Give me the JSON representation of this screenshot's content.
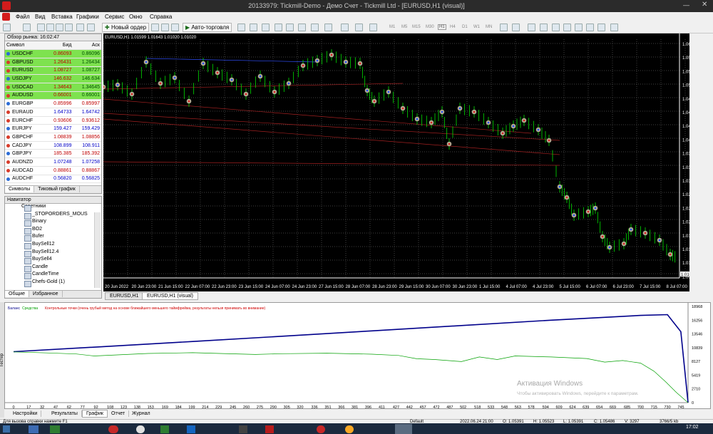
{
  "window": {
    "title": "20133979: Tickmill-Demo - Демо Счет - Tickmill Ltd - [EURUSD,H1 (visual)]"
  },
  "menu": [
    "Файл",
    "Вид",
    "Вставка",
    "Графики",
    "Сервис",
    "Окно",
    "Справка"
  ],
  "toolbar": {
    "new_order": "Новый ордер",
    "auto_trading": "Авто-торговля",
    "timeframes": [
      "M1",
      "M5",
      "M15",
      "M30",
      "H1",
      "H4",
      "D1",
      "W1",
      "MN"
    ]
  },
  "market_watch": {
    "title": "Обзор рынка: 16:02:47",
    "headers": [
      "Символ",
      "Бид",
      "Аск"
    ],
    "rows": [
      [
        "USDCHF",
        "0.86093",
        "0.86096"
      ],
      [
        "GBPUSD",
        "1.26431",
        "1.26434"
      ],
      [
        "EURUSD",
        "1.08727",
        "1.08727"
      ],
      [
        "USDJPY",
        "146.632",
        "146.634"
      ],
      [
        "USDCAD",
        "1.34643",
        "1.34645"
      ],
      [
        "AUDUSD",
        "0.66001",
        "0.66001"
      ],
      [
        "EURGBP",
        "0.85996",
        "0.85997"
      ],
      [
        "EURAUD",
        "1.64733",
        "1.64742"
      ],
      [
        "EURCHF",
        "0.93606",
        "0.93612"
      ],
      [
        "EURJPY",
        "159.427",
        "159.429"
      ],
      [
        "GBPCHF",
        "1.08839",
        "1.08856"
      ],
      [
        "CADJPY",
        "108.899",
        "108.911"
      ],
      [
        "GBPJPY",
        "185.385",
        "185.392"
      ],
      [
        "AUDNZD",
        "1.07248",
        "1.07258"
      ],
      [
        "AUDCAD",
        "0.88861",
        "0.88867"
      ],
      [
        "AUDCHF",
        "0.56820",
        "0.56825"
      ]
    ],
    "tabs": [
      "Символы",
      "Тиковый график"
    ]
  },
  "navigator": {
    "title": "Навигатор",
    "root": "Советники",
    "items": [
      "_STOPORDERS_MOUS",
      "Binary",
      "BO2",
      "Bufer",
      "BuySell12",
      "BuySell12.4",
      "BuySell4",
      "Candle",
      "CandleTime",
      "Chefs-Gold (1)"
    ],
    "tabs": [
      "Общие",
      "Избранное"
    ]
  },
  "chart": {
    "label": "EURUSD,H1  1.01599 1.01643 1.01020 1.01020",
    "price_labels": [
      "1.06215",
      "1.05900",
      "1.05520",
      "1.05280",
      "1.04965",
      "1.04655",
      "1.04340",
      "1.04025",
      "1.03705",
      "1.03395",
      "1.03085",
      "1.02770",
      "1.02460",
      "1.02160",
      "1.01845",
      "1.01535",
      "1.01225",
      "1.00910"
    ],
    "current_price": "1.01020",
    "time_labels": [
      "20 Jun 2022",
      "20 Jun 23:00",
      "21 Jun 15:00",
      "22 Jun 07:00",
      "22 Jun 23:00",
      "23 Jun 15:00",
      "24 Jun 07:00",
      "24 Jun 23:00",
      "27 Jun 15:00",
      "28 Jun 07:00",
      "28 Jun 23:00",
      "29 Jun 15:00",
      "30 Jun 07:00",
      "30 Jun 23:00",
      "1 Jul 15:00",
      "4 Jul 07:00",
      "4 Jul 23:00",
      "5 Jul 15:00",
      "6 Jul 07:00",
      "6 Jul 23:00",
      "7 Jul 15:00",
      "8 Jul 07:00"
    ],
    "tabs": [
      "EURUSD,H1",
      "EURUSD,H1 (visual)"
    ]
  },
  "tester": {
    "legend": [
      "Баланс",
      "Средства",
      "Контрольные точки (очень грубый метод на основе ближайшего меньшего таймфрейма, результаты нельзя принимать во внимание)"
    ],
    "y_labels": [
      "18968",
      "16256",
      "13546",
      "10839",
      "8127",
      "5419",
      "2710",
      "0"
    ],
    "x_labels": [
      "0",
      "17",
      "32",
      "47",
      "62",
      "77",
      "92",
      "108",
      "123",
      "138",
      "153",
      "169",
      "184",
      "199",
      "214",
      "229",
      "245",
      "260",
      "275",
      "290",
      "305",
      "320",
      "336",
      "351",
      "366",
      "381",
      "396",
      "411",
      "427",
      "442",
      "457",
      "472",
      "487",
      "502",
      "518",
      "533",
      "548",
      "563",
      "578",
      "594",
      "609",
      "624",
      "639",
      "654",
      "669",
      "685",
      "700",
      "715",
      "730",
      "745"
    ],
    "tabs": [
      "Настройки",
      "Результаты",
      "График",
      "Отчет",
      "Журнал"
    ],
    "side_label": "Тестер",
    "watermark_title": "Активация Windows",
    "watermark_text": "Чтобы активировать Windows, перейдите к параметрам."
  },
  "status": {
    "help": "Для вызова справки нажмите F1",
    "profile": "Default",
    "time": "2022.06.24 21:00",
    "o": "O: 1.05391",
    "h": "H: 1.05523",
    "l": "L: 1.05391",
    "c": "C: 1.05486",
    "v": "V: 3297",
    "traffic": "3766/5 kb",
    "clock": "17:02"
  },
  "chart_data": [
    {
      "type": "line",
      "series": [
        {
          "name": "Баланс",
          "color": "#00008b",
          "x": [
            0,
            100,
            200,
            300,
            400,
            500,
            600,
            700,
            730,
            745,
            753
          ],
          "values": [
            10050,
            11050,
            12050,
            13100,
            14150,
            15200,
            16250,
            17200,
            17350,
            14000,
            0
          ]
        },
        {
          "name": "Средства",
          "color": "#00a000",
          "x": [
            0,
            40,
            70,
            90,
            150,
            200,
            230,
            270,
            300,
            350,
            400,
            430,
            450,
            470,
            500,
            520,
            540,
            560,
            600,
            640,
            660,
            680,
            700,
            715,
            728,
            740,
            753
          ],
          "values": [
            10000,
            9800,
            9600,
            9200,
            9700,
            9850,
            9700,
            9500,
            9650,
            9750,
            9550,
            9300,
            8650,
            8500,
            8100,
            9000,
            8500,
            9200,
            9000,
            8700,
            8000,
            8300,
            7800,
            6200,
            4100,
            2000,
            0
          ]
        }
      ],
      "xlim": [
        0,
        753
      ],
      "ylim": [
        0,
        18968
      ]
    }
  ]
}
